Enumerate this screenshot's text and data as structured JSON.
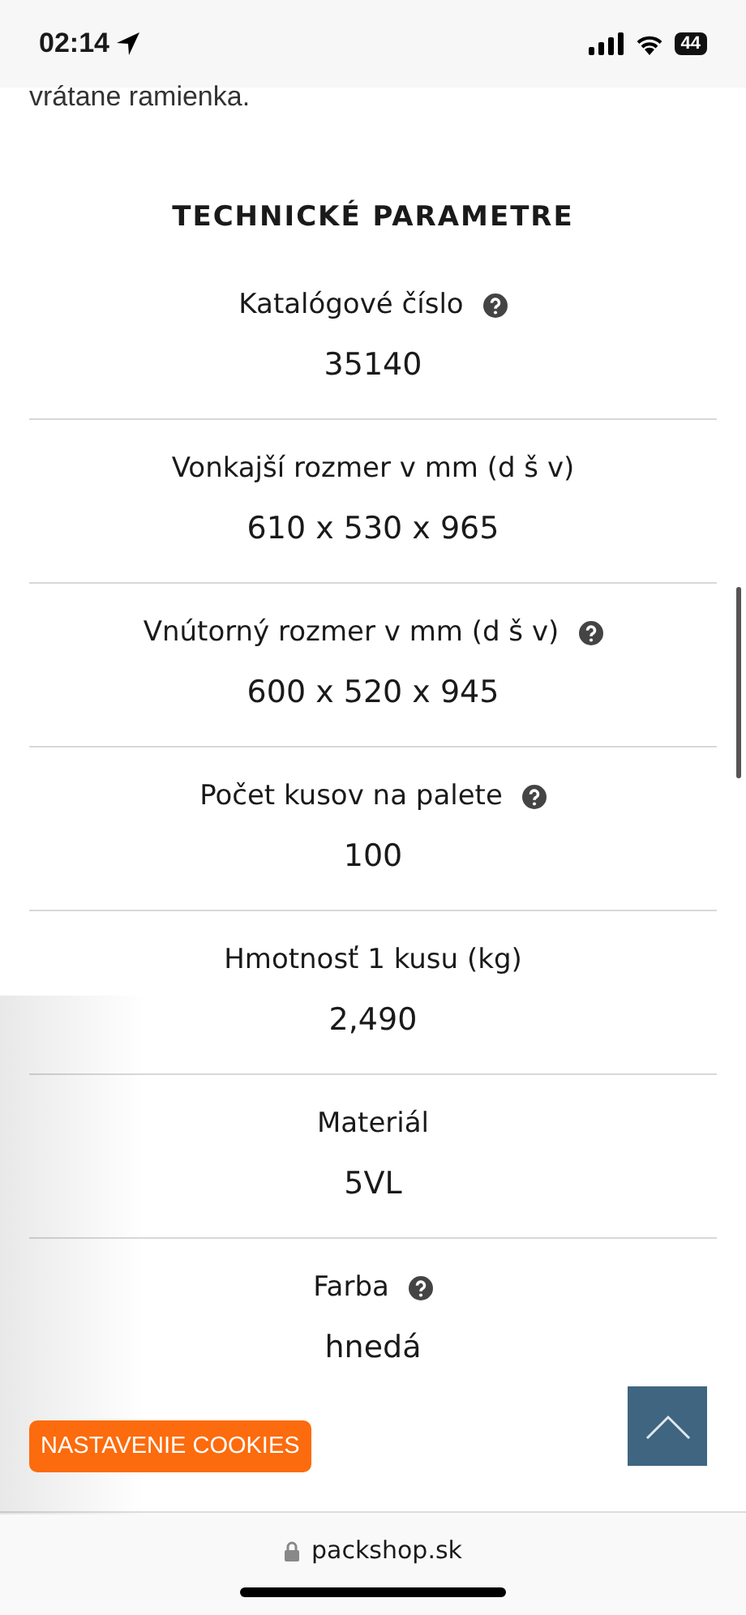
{
  "status_bar": {
    "time": "02:14",
    "battery": "44"
  },
  "intro_text": "vrátane ramienka.",
  "section_title": "TECHNICKÉ PARAMETRE",
  "parameters": [
    {
      "label": "Katalógové číslo",
      "value": "35140",
      "help": true
    },
    {
      "label": "Vonkajší rozmer v mm (d š v)",
      "value": "610 x 530 x 965",
      "help": false
    },
    {
      "label": "Vnútorný rozmer v mm (d š v)",
      "value": "600 x 520 x 945",
      "help": true
    },
    {
      "label": "Počet kusov na palete",
      "value": "100",
      "help": true
    },
    {
      "label": "Hmotnosť 1 kusu (kg)",
      "value": "2,490",
      "help": false
    },
    {
      "label": "Materiál",
      "value": "5VL",
      "help": false
    },
    {
      "label": "Farba",
      "value": "hnedá",
      "help": true
    }
  ],
  "cookie_button": "NASTAVENIE COOKIES",
  "address_bar": {
    "domain": "packshop.sk"
  }
}
